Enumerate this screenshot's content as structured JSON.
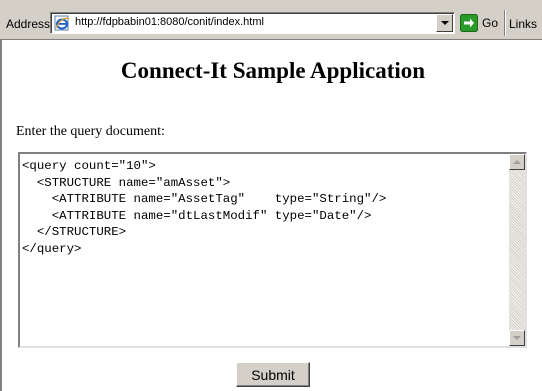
{
  "address_bar": {
    "label": "Address",
    "url": "http://fdpbabin01:8080/conit/index.html",
    "go_label": "Go",
    "links_label": "Links"
  },
  "page": {
    "title": "Connect-It Sample Application",
    "prompt": "Enter the query document:",
    "query_value": "<query count=\"10\">\n  <STRUCTURE name=\"amAsset\">\n    <ATTRIBUTE name=\"AssetTag\"    type=\"String\"/>\n    <ATTRIBUTE name=\"dtLastModif\" type=\"Date\"/>\n  </STRUCTURE>\n</query>",
    "submit_label": "Submit"
  },
  "icons": {
    "page": "ie-page-icon",
    "go": "go-arrow-icon",
    "dropdown": "chevron-down-icon",
    "scroll_up": "scroll-up-icon",
    "scroll_down": "scroll-down-icon"
  },
  "colors": {
    "chrome": "#d4d0c8",
    "go_green": "#2a9a2a"
  }
}
